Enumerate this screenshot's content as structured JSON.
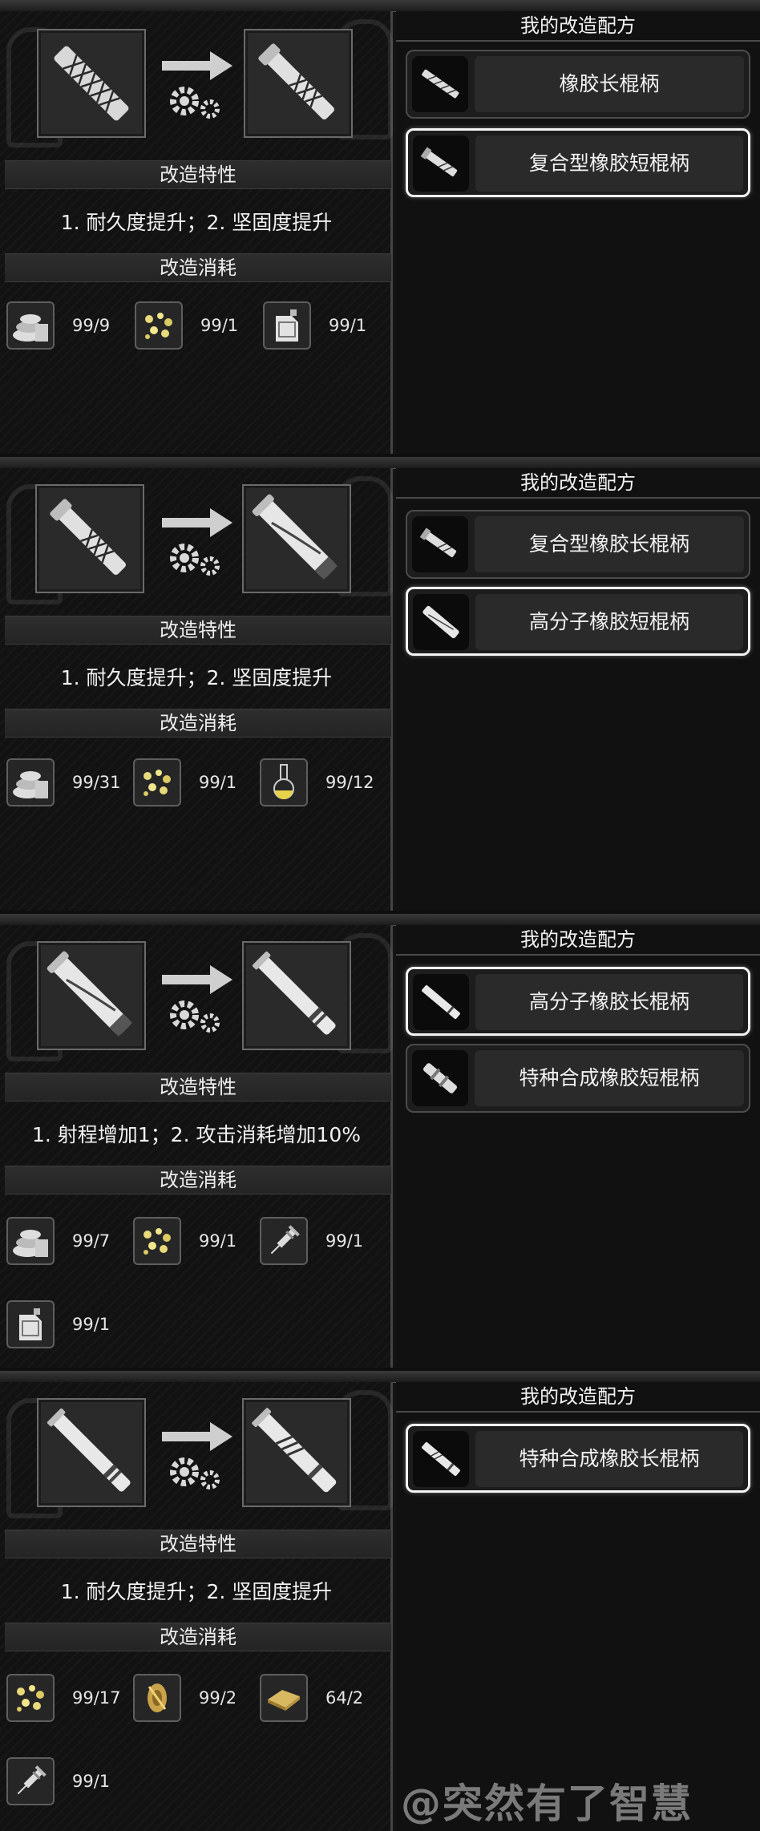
{
  "panels": [
    {
      "traits_title": "改造特性",
      "traits_text": "1. 耐久度提升；2. 坚固度提升",
      "cost_title": "改造消耗",
      "materials": [
        {
          "icon": "rubber-roll-icon",
          "count": "99/9"
        },
        {
          "icon": "gold-nuggets-icon",
          "count": "99/1"
        },
        {
          "icon": "jerrycan-icon",
          "count": "99/1"
        }
      ],
      "right_title": "我的改造配方",
      "recipes": [
        {
          "label": "橡胶长棍柄",
          "selected": false
        },
        {
          "label": "复合型橡胶短棍柄",
          "selected": true
        }
      ]
    },
    {
      "traits_title": "改造特性",
      "traits_text": "1. 耐久度提升；2. 坚固度提升",
      "cost_title": "改造消耗",
      "materials": [
        {
          "icon": "rubber-roll-icon",
          "count": "99/31"
        },
        {
          "icon": "gold-nuggets-icon",
          "count": "99/1"
        },
        {
          "icon": "flask-icon",
          "count": "99/12"
        }
      ],
      "right_title": "我的改造配方",
      "recipes": [
        {
          "label": "复合型橡胶长棍柄",
          "selected": false
        },
        {
          "label": "高分子橡胶短棍柄",
          "selected": true
        }
      ]
    },
    {
      "traits_title": "改造特性",
      "traits_text": "1. 射程增加1；2. 攻击消耗增加10%",
      "cost_title": "改造消耗",
      "materials": [
        {
          "icon": "rubber-roll-icon",
          "count": "99/7"
        },
        {
          "icon": "gold-nuggets-icon",
          "count": "99/1"
        },
        {
          "icon": "syringe-icon",
          "count": "99/1"
        },
        {
          "icon": "jerrycan-icon",
          "count": "99/1"
        }
      ],
      "right_title": "我的改造配方",
      "recipes": [
        {
          "label": "高分子橡胶长棍柄",
          "selected": true
        },
        {
          "label": "特种合成橡胶短棍柄",
          "selected": false
        }
      ]
    },
    {
      "traits_title": "改造特性",
      "traits_text": "1. 耐久度提升；2. 坚固度提升",
      "cost_title": "改造消耗",
      "materials": [
        {
          "icon": "gold-nuggets-icon",
          "count": "99/17"
        },
        {
          "icon": "gold-spool-icon",
          "count": "99/2"
        },
        {
          "icon": "gold-plate-icon",
          "count": "64/2"
        },
        {
          "icon": "syringe-icon",
          "count": "99/1"
        }
      ],
      "right_title": "我的改造配方",
      "recipes": [
        {
          "label": "特种合成橡胶长棍柄",
          "selected": true
        }
      ]
    }
  ],
  "watermark": "@突然有了智慧"
}
